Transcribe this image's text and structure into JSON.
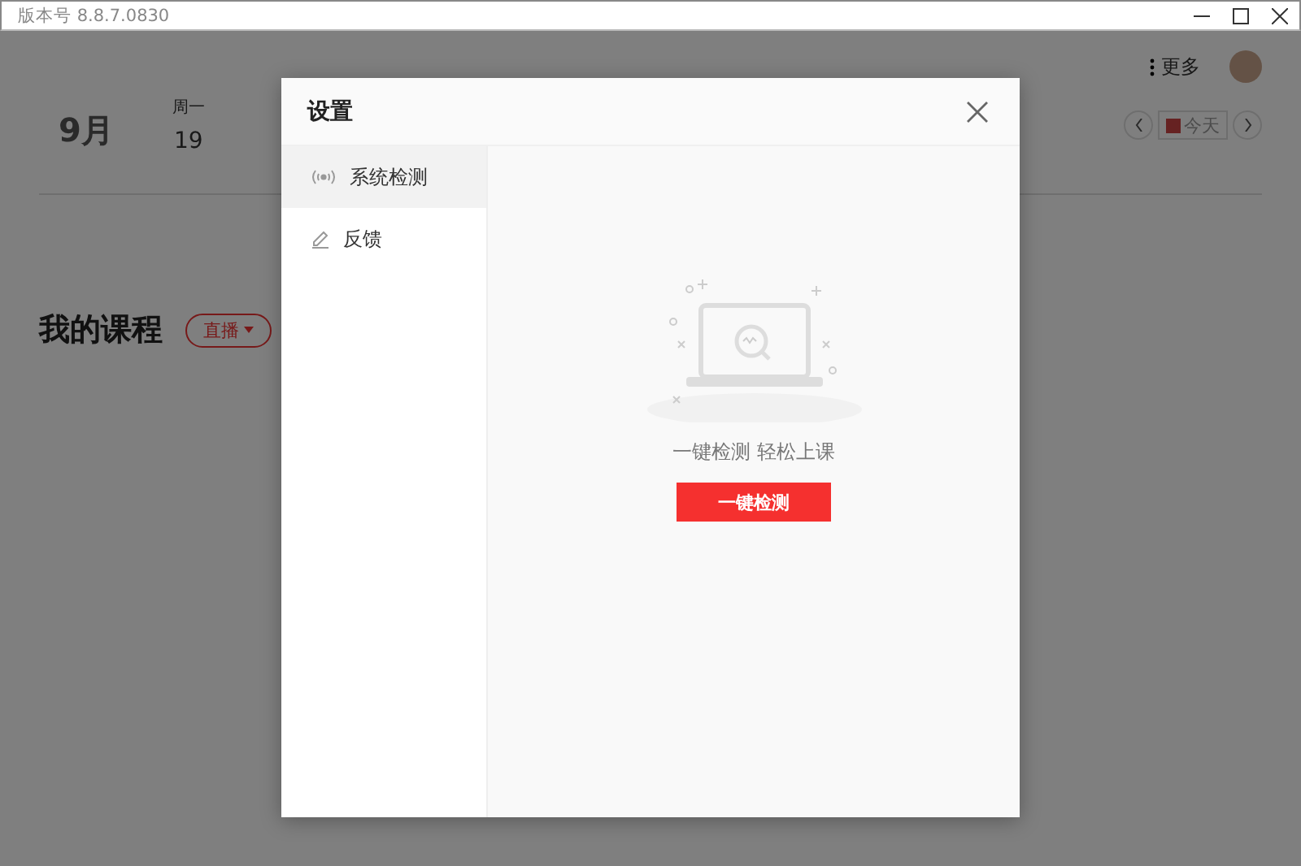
{
  "window": {
    "version": "版本号 8.8.7.0830"
  },
  "header": {
    "more": "更多"
  },
  "calendar": {
    "month": "9月",
    "days": [
      {
        "weekday": "周一",
        "date": "19"
      }
    ],
    "today_button": "今天"
  },
  "courses": {
    "title": "我的课程",
    "filter": "直播"
  },
  "dialog": {
    "title": "设置",
    "menu": [
      {
        "label": "系统检测",
        "kind": "signal",
        "selected": true
      },
      {
        "label": "反馈",
        "kind": "pencil",
        "selected": false
      }
    ],
    "empty_text": "一键检测 轻松上课",
    "action": "一键检测"
  }
}
